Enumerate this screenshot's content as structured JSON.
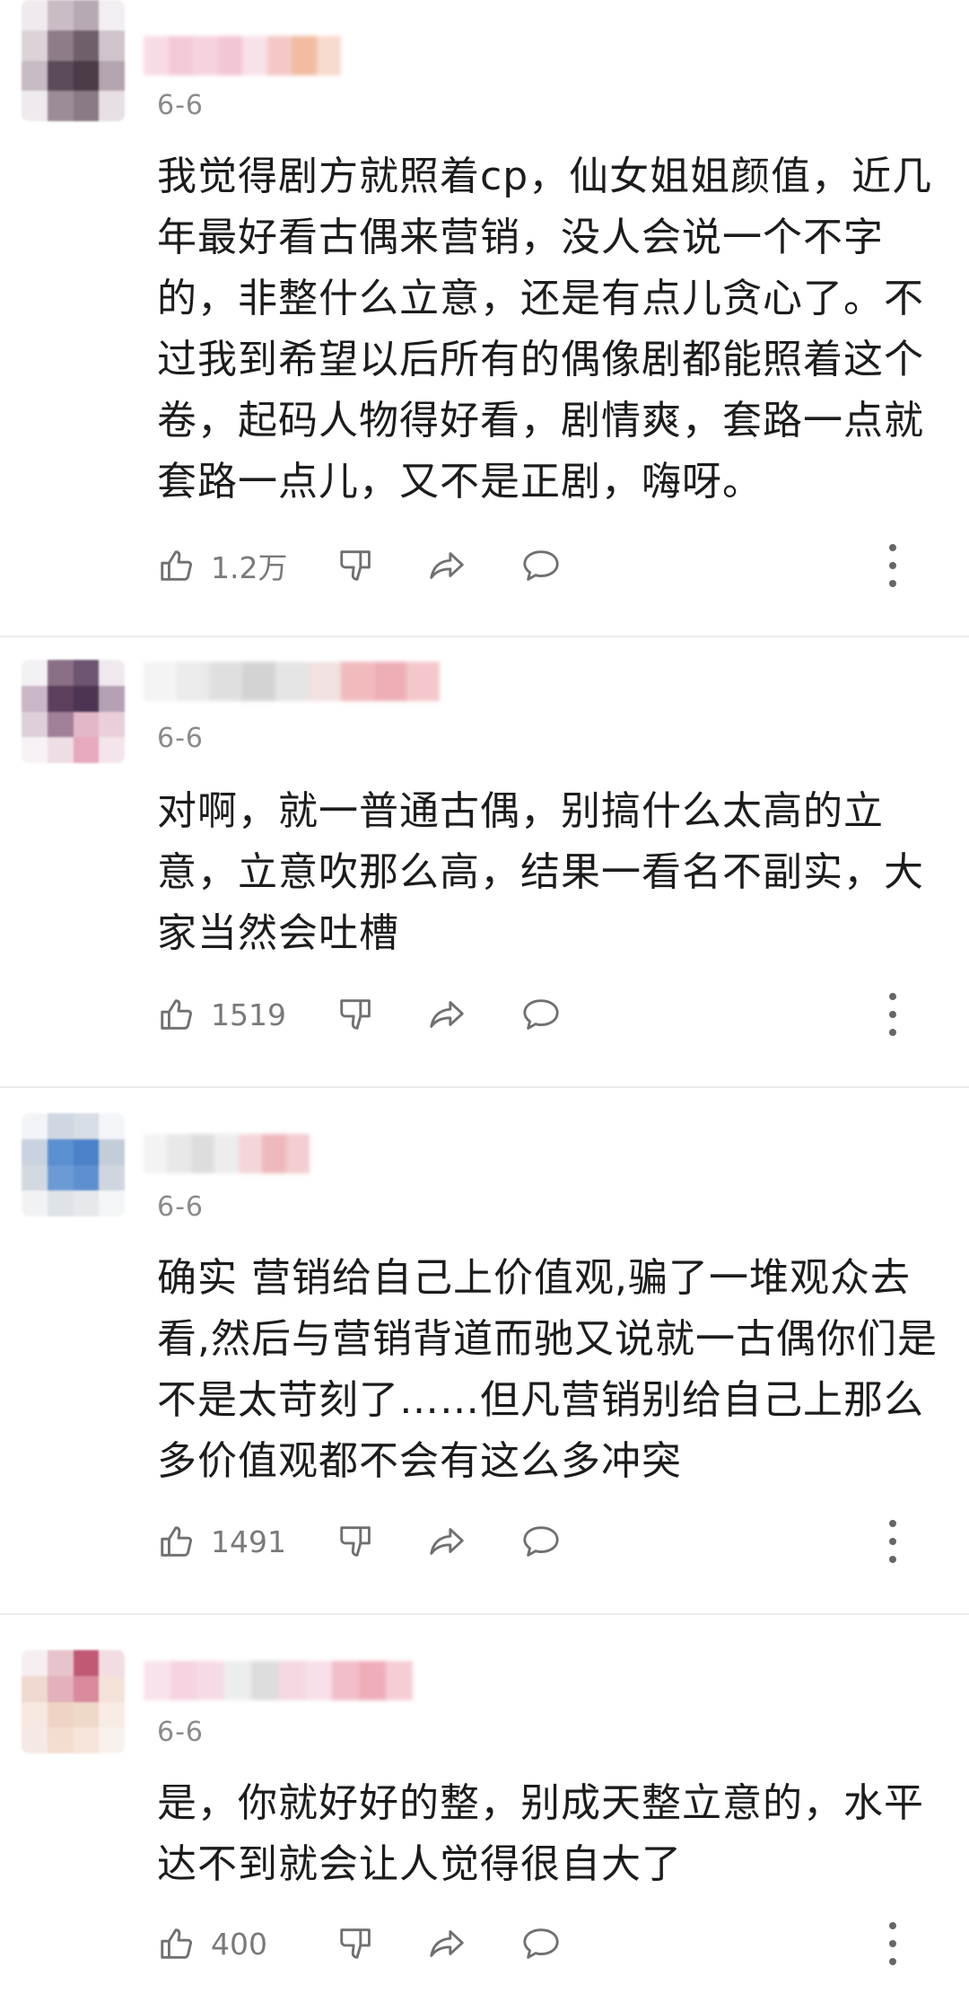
{
  "comments": [
    {
      "date": "6-6",
      "text": "我觉得剧方就照着cp，仙女姐姐颜值，近几\n年最好看古偶来营销，没人会说一个不字\n的，非整什么立意，还是有点儿贪心了。不\n过我到希望以后所有的偶像剧都能照着这个\n卷，起码人物得好看，剧情爽，套路一点就\n套路一点儿，又不是正剧，嗨呀。",
      "likes": "1.2万",
      "avatar_colors": [
        "#efeaee",
        "#c9bcc5",
        "#b7a9b4",
        "#f2eef1",
        "#dcd3d9",
        "#8e7d89",
        "#6f5f6b",
        "#cfc4cc",
        "#c7bbc4",
        "#5c4b58",
        "#4a3b47",
        "#b3a4af",
        "#efeaee",
        "#9c8c98",
        "#8a7a86",
        "#e6dfe4"
      ],
      "name_colors": [
        "#f7d9e3",
        "#f2c4d3",
        "#f5cfdb",
        "#f1c0d1",
        "#f8dfe7",
        "#f2c3c1",
        "#f0b596",
        "#f6d7c8"
      ]
    },
    {
      "date": "6-6",
      "text": "对啊，就一普通古偶，别搞什么太高的立\n意，立意吹那么高，结果一看名不副实，大\n家当然会吐槽",
      "likes": "1519",
      "avatar_colors": [
        "#f4f1f4",
        "#8a6f86",
        "#6b5570",
        "#efe9ee",
        "#c9b6c6",
        "#5d3f5c",
        "#4b3552",
        "#b5a1b6",
        "#ddd0da",
        "#a07f99",
        "#e2b8c8",
        "#e9cfd9",
        "#f6f2f5",
        "#eedde5",
        "#e7a9bd",
        "#f4e4eb"
      ],
      "name_colors": [
        "#f3f3f3",
        "#e9e9e9",
        "#dcdcdc",
        "#cfcfcf",
        "#e3e3e3",
        "#f0dede",
        "#f0b4b8",
        "#eca6ae",
        "#f3c3c6"
      ]
    },
    {
      "date": "6-6",
      "text": "确实 营销给自己上价值观,骗了一堆观众去\n看,然后与营销背道而驰又说就一古偶你们是\n不是太苛刻了……但凡营销别给自己上那么\n多价值观都不会有这么多冲突",
      "likes": "1491",
      "avatar_colors": [
        "#f2f4f7",
        "#cfd7e2",
        "#d8dee6",
        "#f3f5f8",
        "#c9d3df",
        "#5a8fd1",
        "#4b82c9",
        "#c3cdda",
        "#d3d9e1",
        "#6b9ad6",
        "#5e8fcf",
        "#cfd6df",
        "#f1f2f4",
        "#dfe2e6",
        "#e6e8ec",
        "#f4f5f6"
      ],
      "name_colors": [
        "#f2f2f2",
        "#e6e6e6",
        "#dadada",
        "#ececec",
        "#f4d2d4",
        "#eeb1b5",
        "#f2c8ca"
      ]
    },
    {
      "date": "6-6",
      "text": "是，你就好好的整，别成天整立意的，水平\n达不到就会让人觉得很自大了",
      "likes": "400",
      "avatar_colors": [
        "#f6eef0",
        "#e7c4cc",
        "#c05a74",
        "#f1dde2",
        "#efd9d0",
        "#e3b0bb",
        "#d98a9d",
        "#f4e2d9",
        "#f6e8e0",
        "#efd3c4",
        "#f0d8c8",
        "#f8ece4",
        "#f4e9e3",
        "#f2ddd0",
        "#f6e5da",
        "#f9f1ec"
      ],
      "name_colors": [
        "#f8e0ea",
        "#f4cfde",
        "#f6d8e5",
        "#ececec",
        "#d9d9d9",
        "#f4d3de",
        "#f7dde7",
        "#f1b7c4",
        "#eda5b2",
        "#f4c9d1"
      ]
    }
  ]
}
